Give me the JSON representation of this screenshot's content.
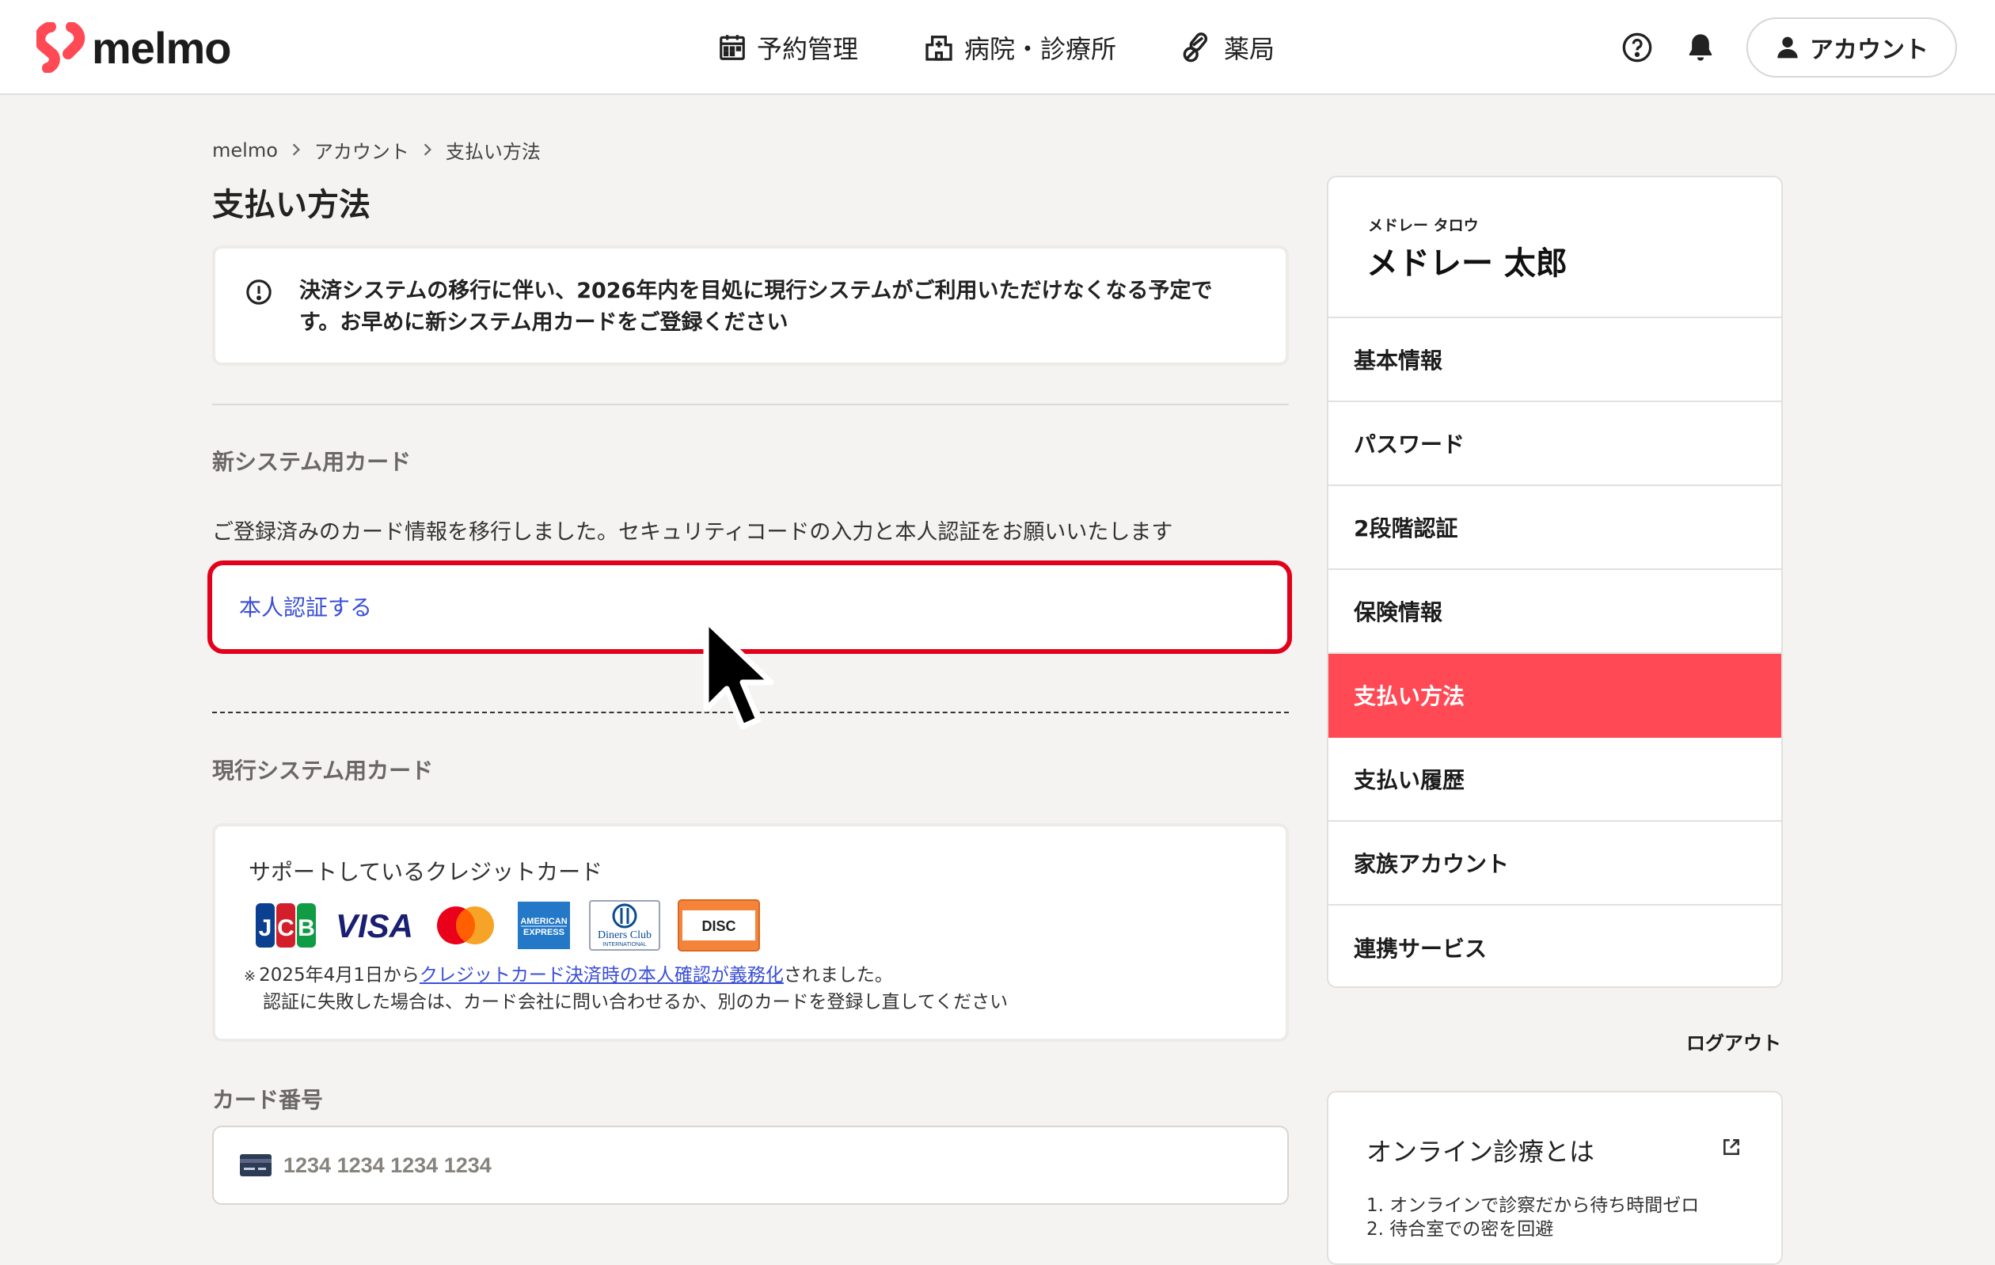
{
  "header": {
    "logo_text": "melmo",
    "nav": [
      {
        "label": "予約管理",
        "icon": "calendar-icon"
      },
      {
        "label": "病院・診療所",
        "icon": "hospital-icon"
      },
      {
        "label": "薬局",
        "icon": "pills-icon"
      }
    ],
    "help_icon": "help-circle-icon",
    "bell_icon": "bell-icon",
    "account_label": "アカウント"
  },
  "breadcrumb": [
    "melmo",
    "アカウント",
    "支払い方法"
  ],
  "page_title": "支払い方法",
  "notice": {
    "icon": "alert-circle-icon",
    "text": "決済システムの移行に伴い、2026年内を目処に現行システムがご利用いただけなくなる予定です。お早めに新システム用カードをご登録ください"
  },
  "new_system": {
    "label": "新システム用カード",
    "description": "ご登録済みのカード情報を移行しました。セキュリティコードの入力と本人認証をお願いいたします",
    "auth_link": "本人認証する"
  },
  "current_system": {
    "label": "現行システム用カード",
    "supported_title": "サポートしているクレジットカード",
    "brands": [
      "JCB",
      "VISA",
      "Mastercard",
      "American Express",
      "Diners Club International",
      "DISCOVER"
    ],
    "note_mark": "※",
    "note_prefix": "2025年4月1日から",
    "note_link": "クレジットカード決済時の本人確認が義務化",
    "note_suffix": "されました。",
    "note_line2": "認証に失敗した場合は、カード会社に問い合わせるか、別のカードを登録し直してください"
  },
  "card_number": {
    "label": "カード番号",
    "placeholder": "1234 1234 1234 1234",
    "icon": "credit-card-icon"
  },
  "sidebar": {
    "kana": "メドレー タロウ",
    "name": "メドレー 太郎",
    "items": [
      {
        "label": "基本情報",
        "active": false
      },
      {
        "label": "パスワード",
        "active": false
      },
      {
        "label": "2段階認証",
        "active": false
      },
      {
        "label": "保険情報",
        "active": false
      },
      {
        "label": "支払い方法",
        "active": true
      },
      {
        "label": "支払い履歴",
        "active": false
      },
      {
        "label": "家族アカウント",
        "active": false
      },
      {
        "label": "連携サービス",
        "active": false
      }
    ],
    "logout": "ログアウト"
  },
  "info_card": {
    "title": "オンライン診療とは",
    "icon": "external-link-icon",
    "items": [
      "1. オンラインで診察だから待ち時間ゼロ",
      "2. 待合室での密を回避"
    ]
  },
  "colors": {
    "accent": "#ff4a55",
    "link": "#3a4fd6",
    "highlight": "#e2001a",
    "background": "#f4f3f1"
  }
}
